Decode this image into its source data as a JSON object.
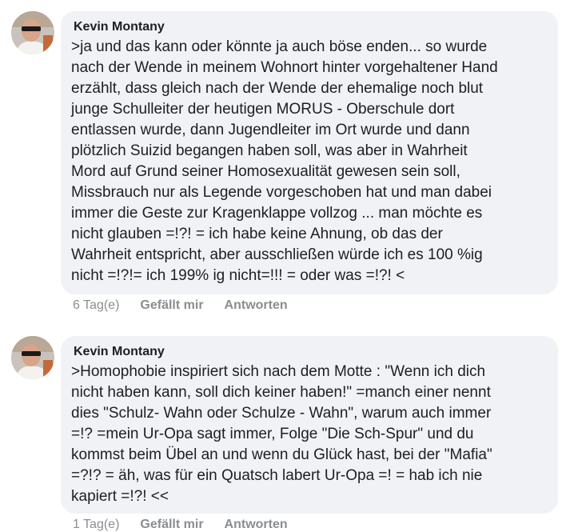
{
  "comments": [
    {
      "author": "Kevin Montany",
      "text": ">ja und das kann oder könnte ja auch böse enden... so wurde\nnach der Wende in meinem Wohnort hinter vorgehaltener Hand\nerzählt, dass gleich nach der Wende der ehemalige noch blut\njunge Schulleiter der heutigen MORUS - Oberschule dort\nentlassen wurde, dann Jugendleiter im Ort wurde  und dann\nplötzlich Suizid begangen haben soll, was aber in Wahrheit\nMord auf Grund seiner Homosexualität gewesen sein soll,\nMissbrauch nur als Legende vorgeschoben hat und man dabei\nimmer die Geste zur Kragenklappe vollzog ... man möchte es\nnicht glauben =!?! = ich habe keine Ahnung, ob das der\nWahrheit entspricht, aber ausschließen würde ich es 100 %ig\nnicht =!?!= ich 199% ig nicht=!!! = oder was =!?! <",
      "time": "6 Tag(e)",
      "like_label": "Gefällt mir",
      "reply_label": "Antworten"
    },
    {
      "author": "Kevin Montany",
      "text": ">Homophobie inspiriert sich nach dem Motte : \"Wenn ich dich\nnicht haben kann, soll dich keiner haben!\" =manch einer nennt\ndies  \"Schulz- Wahn oder Schulze - Wahn\", warum auch immer\n=!? =mein Ur-Opa sagt immer, Folge \"Die Sch-Spur\" und du\nkommst beim Übel an und wenn du Glück hast, bei der \"Mafia\"\n=?!? = äh, was für ein Quatsch labert Ur-Opa =! = hab ich nie\nkapiert =!?! <<",
      "time": "1 Tag(e)",
      "like_label": "Gefällt mir",
      "reply_label": "Antworten"
    }
  ],
  "colors": {
    "bubble": "#f0f2f5",
    "text": "#1c1e21",
    "meta": "#8a8d91"
  }
}
